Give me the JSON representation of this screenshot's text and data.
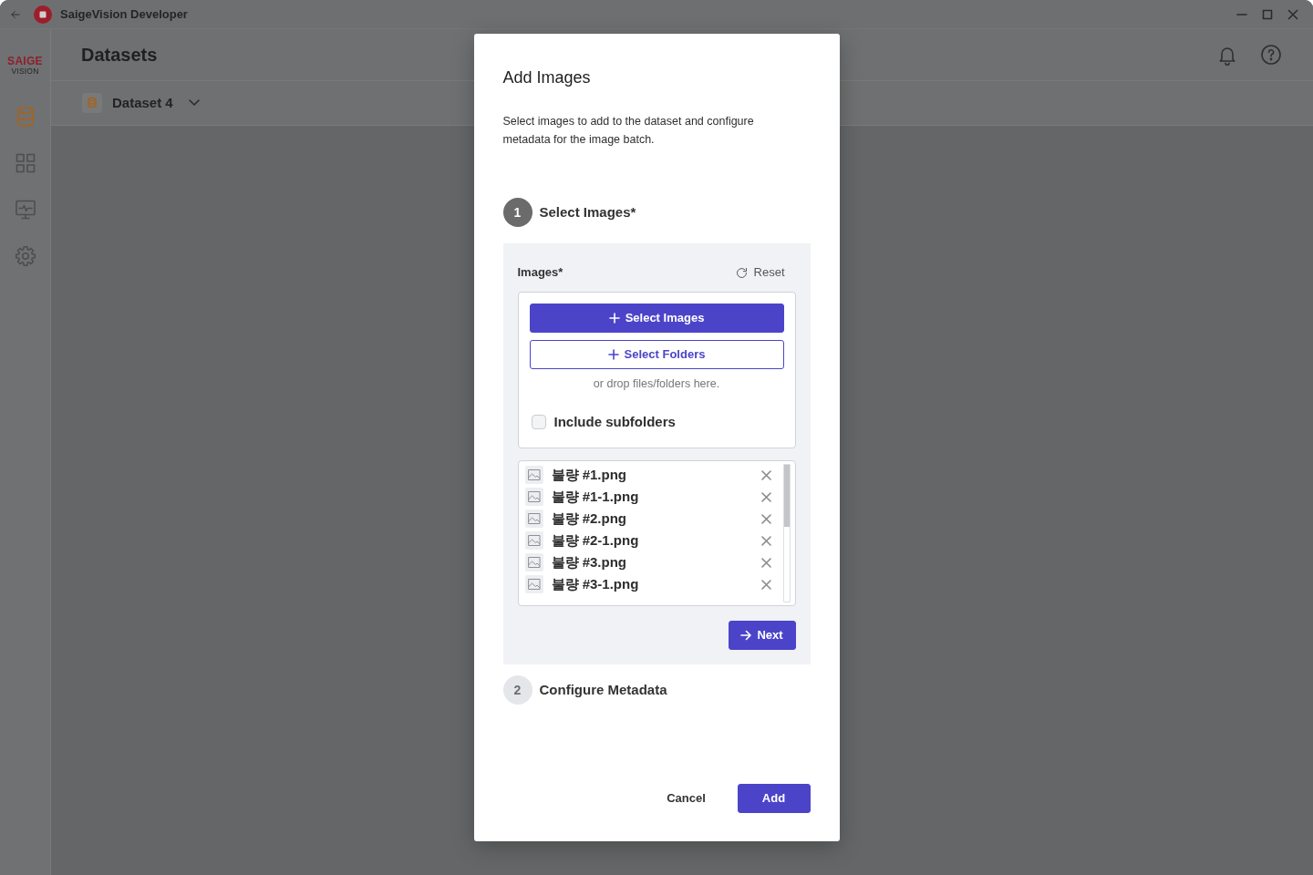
{
  "window": {
    "title": "SaigeVision Developer"
  },
  "sidebar": {
    "logo": {
      "line1": "SAIGE",
      "line2": "VISION"
    },
    "items": [
      {
        "kind": "database",
        "selected": true
      },
      {
        "kind": "grid",
        "selected": false
      },
      {
        "kind": "monitor",
        "selected": false
      },
      {
        "kind": "settings",
        "selected": false
      }
    ]
  },
  "header": {
    "title": "Datasets"
  },
  "dataset_selector": {
    "label": "Dataset 4"
  },
  "dialog": {
    "title": "Add Images",
    "description": "Select images to add to the dataset and configure metadata for the image batch.",
    "steps": [
      {
        "number": "1",
        "title": "Select Images*",
        "active": true
      },
      {
        "number": "2",
        "title": "Configure Metadata",
        "active": false
      }
    ],
    "images_field": {
      "label": "Images*",
      "reset": "Reset",
      "select_images": "Select Images",
      "select_folders": "Select Folders",
      "drop_hint": "or drop files/folders here.",
      "include_subfolders": {
        "label": "Include subfolders",
        "checked": false
      },
      "files": [
        {
          "name": "불량 #1.png"
        },
        {
          "name": "불량 #1-1.png"
        },
        {
          "name": "불량 #2.png"
        },
        {
          "name": "불량 #2-1.png"
        },
        {
          "name": "불량 #3.png"
        },
        {
          "name": "불량 #3-1.png"
        }
      ]
    },
    "next": "Next",
    "buttons": [
      {
        "label": "Cancel",
        "kind": "text"
      },
      {
        "label": "Add",
        "kind": "primary"
      }
    ]
  }
}
